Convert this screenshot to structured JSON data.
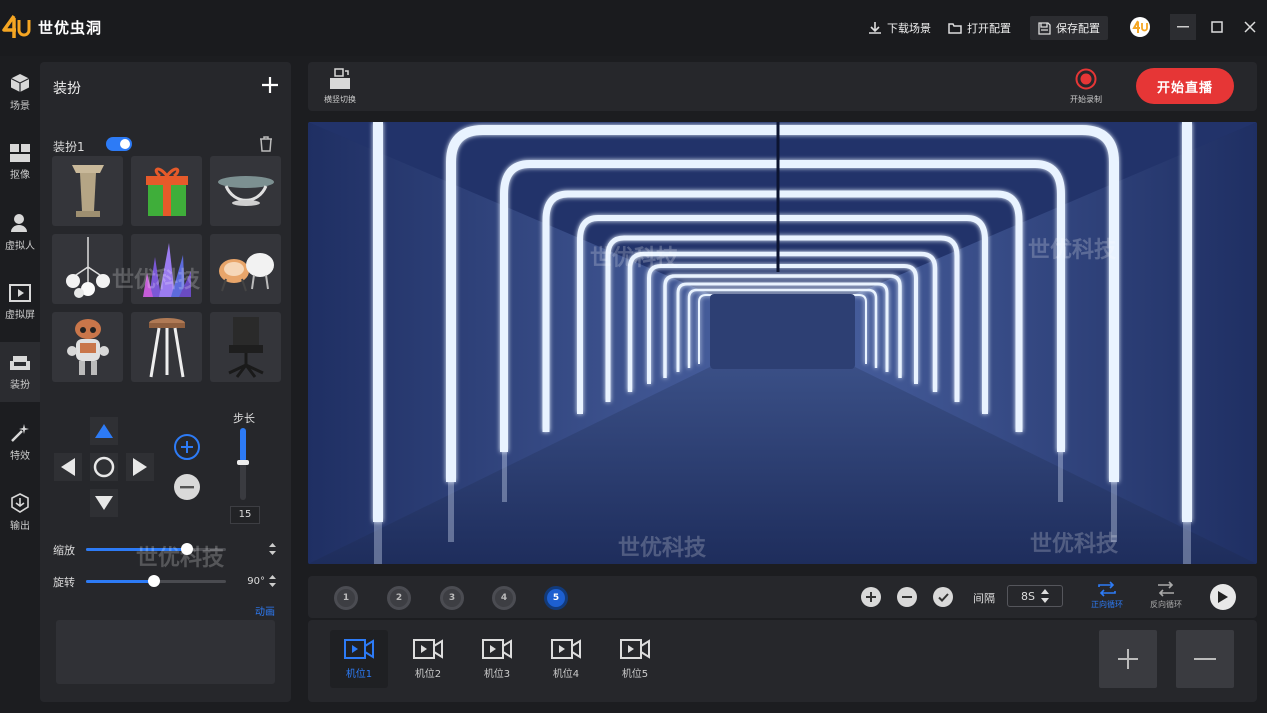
{
  "app": {
    "title": "世优虫洞"
  },
  "titlebar": {
    "download_scene": "下载场景",
    "open_config": "打开配置",
    "save_config": "保存配置"
  },
  "rail": [
    {
      "label": "场景",
      "icon": "cube-icon"
    },
    {
      "label": "抠像",
      "icon": "matting-icon"
    },
    {
      "label": "虚拟人",
      "icon": "avatar-icon"
    },
    {
      "label": "虚拟屏",
      "icon": "screen-icon"
    },
    {
      "label": "装扮",
      "icon": "sofa-icon",
      "active": true
    },
    {
      "label": "特效",
      "icon": "sparkle-icon"
    },
    {
      "label": "输出",
      "icon": "output-icon"
    }
  ],
  "panel": {
    "title": "装扮",
    "set_label": "装扮1",
    "enabled": true,
    "step_label": "步长",
    "step_value": "15",
    "scale_label": "缩放",
    "scale_value": 0.72,
    "rotate_label": "旋转",
    "rotate_value": "90°",
    "animation_link": "动画"
  },
  "toolbar": {
    "layout_switch": "横竖切换",
    "record": "开始录制",
    "go_live": "开始直播"
  },
  "presets": {
    "numbers": [
      "1",
      "2",
      "3",
      "4",
      "5"
    ],
    "active": "5",
    "interval_label": "间隔",
    "interval_value": "8S",
    "forward_loop": "正向循环",
    "reverse_loop": "反向循环"
  },
  "cameras": [
    "机位1",
    "机位2",
    "机位3",
    "机位4",
    "机位5"
  ],
  "watermark": {
    "brand": "世优科技",
    "tile": "4U"
  },
  "colors": {
    "accent": "#2d7bf6",
    "live": "#e63636",
    "tunnel": "#2a3f7a"
  }
}
